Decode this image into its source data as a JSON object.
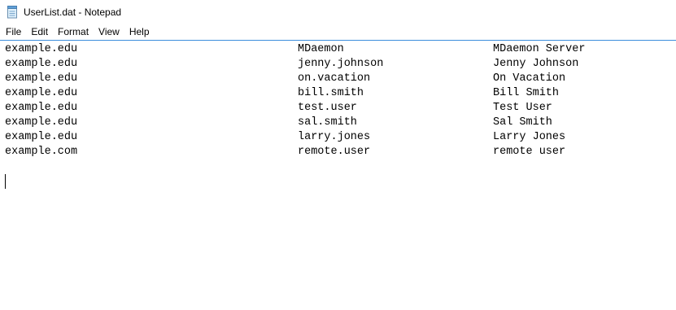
{
  "window": {
    "title": "UserList.dat - Notepad",
    "icon": "notepad-icon"
  },
  "menu": {
    "items": [
      {
        "label": "File"
      },
      {
        "label": "Edit"
      },
      {
        "label": "Format"
      },
      {
        "label": "View"
      },
      {
        "label": "Help"
      }
    ]
  },
  "document": {
    "lines": [
      {
        "domain": "example.edu",
        "username": "MDaemon",
        "full_name": "MDaemon Server"
      },
      {
        "domain": "example.edu",
        "username": "jenny.johnson",
        "full_name": "Jenny Johnson"
      },
      {
        "domain": "example.edu",
        "username": "on.vacation",
        "full_name": "On Vacation"
      },
      {
        "domain": "example.edu",
        "username": "bill.smith",
        "full_name": "Bill Smith"
      },
      {
        "domain": "example.edu",
        "username": "test.user",
        "full_name": "Test User"
      },
      {
        "domain": "example.edu",
        "username": "sal.smith",
        "full_name": "Sal Smith"
      },
      {
        "domain": "example.edu",
        "username": "larry.jones",
        "full_name": "Larry Jones"
      },
      {
        "domain": "example.com",
        "username": "remote.user",
        "full_name": "remote user"
      }
    ]
  }
}
